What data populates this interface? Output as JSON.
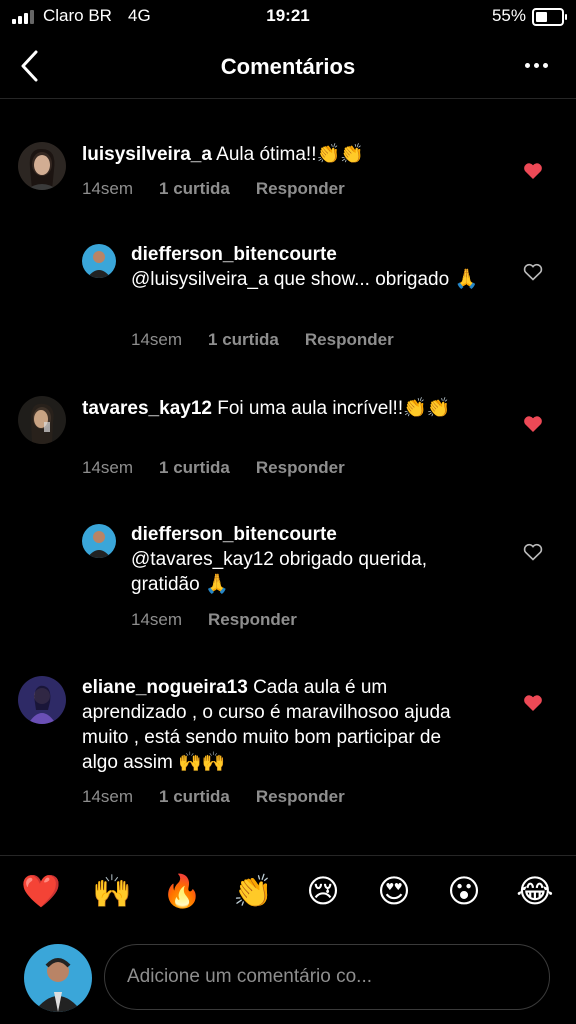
{
  "status_bar": {
    "carrier": "Claro BR",
    "network": "4G",
    "time": "19:21",
    "battery": "55%",
    "battery_level": 0.55
  },
  "header": {
    "title": "Comentários"
  },
  "comments": [
    {
      "username": "luisysilveira_a",
      "text": " Aula ótima!!👏👏",
      "age": "14sem",
      "likes": "1 curtida",
      "reply": "Responder",
      "liked": true
    },
    {
      "username": "diefferson_bitencourte",
      "text": "@luisysilveira_a que show... obrigado 🙏",
      "age": "14sem",
      "likes": "1 curtida",
      "reply": "Responder",
      "liked": false
    },
    {
      "username": "tavares_kay12",
      "text": " Foi uma aula incrível!!👏👏",
      "age": "14sem",
      "likes": "1 curtida",
      "reply": "Responder",
      "liked": true
    },
    {
      "username": "diefferson_bitencourte",
      "text": "@tavares_kay12 obrigado querida, gratidão 🙏",
      "age": "14sem",
      "likes": "",
      "reply": "Responder",
      "liked": false
    },
    {
      "username": "eliane_nogueira13",
      "text": " Cada aula é um aprendizado , o curso é maravilhosoo ajuda muito , está sendo muito bom participar de algo assim 🙌🙌",
      "age": "14sem",
      "likes": "1 curtida",
      "reply": "Responder",
      "liked": true
    }
  ],
  "quick_emojis": [
    "❤️",
    "🙌",
    "🔥",
    "👏",
    "😢",
    "😍",
    "😮",
    "😂"
  ],
  "composer": {
    "placeholder": "Adicione um comentário co..."
  },
  "colors": {
    "heart": "#ed4956",
    "muted": "#8e8e8e",
    "background": "#000000"
  }
}
